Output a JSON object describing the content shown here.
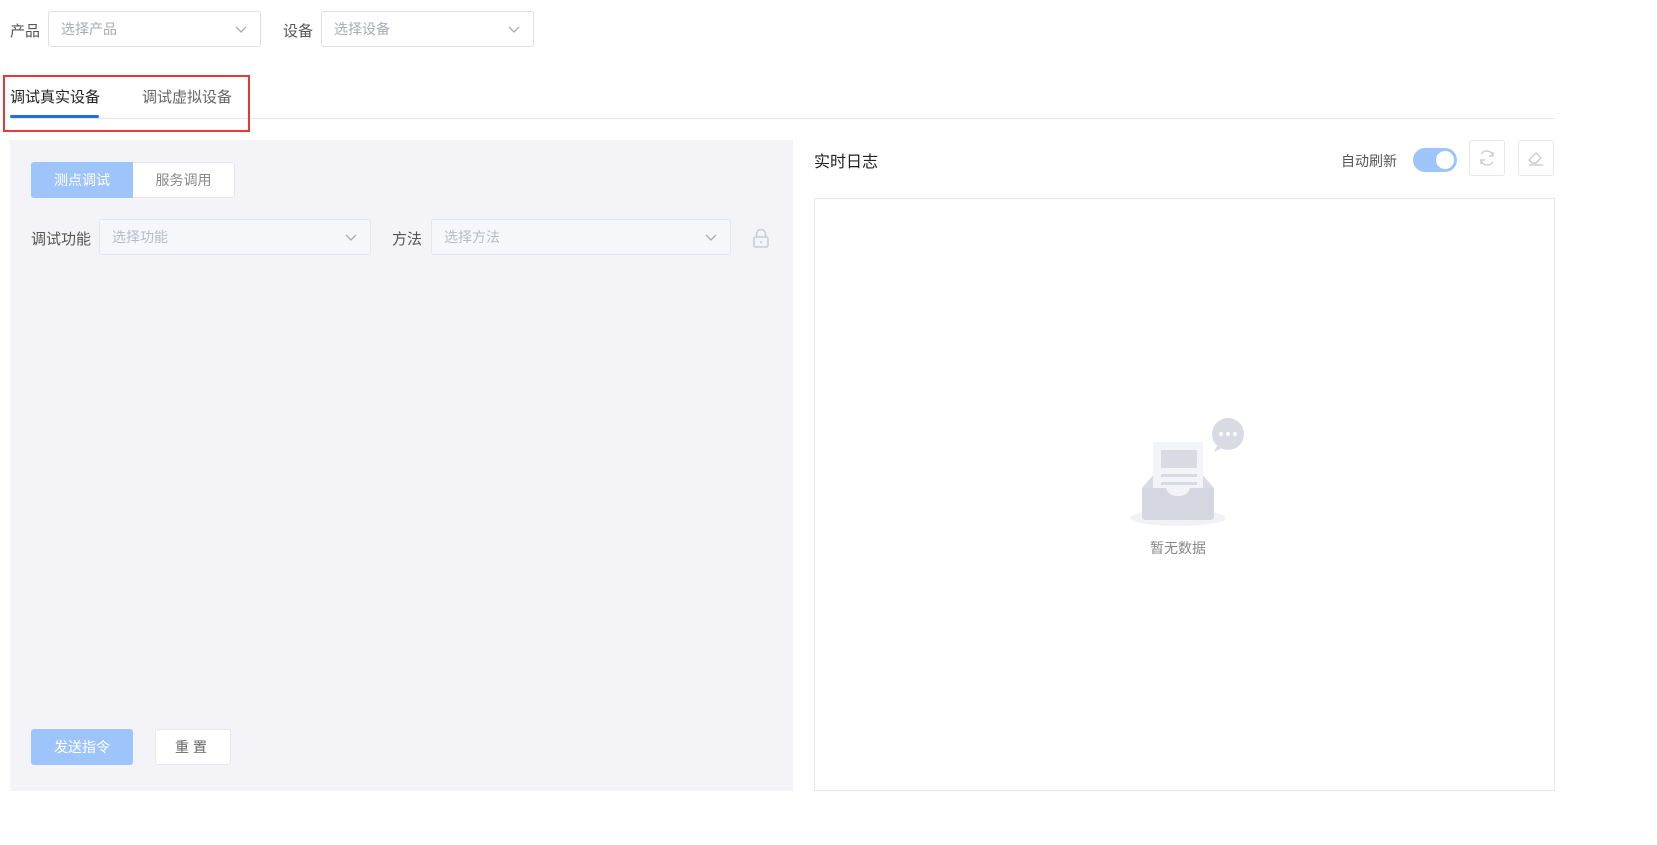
{
  "filters": {
    "product_label": "产品",
    "product_placeholder": "选择产品",
    "device_label": "设备",
    "device_placeholder": "选择设备"
  },
  "tabs": [
    {
      "label": "调试真实设备",
      "active": true
    },
    {
      "label": "调试虚拟设备",
      "active": false
    }
  ],
  "debug_panel": {
    "segments": [
      {
        "label": "测点调试",
        "active": true
      },
      {
        "label": "服务调用",
        "active": false
      }
    ],
    "function_label": "调试功能",
    "function_placeholder": "选择功能",
    "method_label": "方法",
    "method_placeholder": "选择方法",
    "send_button": "发送指令",
    "reset_button": "重置"
  },
  "log_panel": {
    "title": "实时日志",
    "auto_refresh_label": "自动刷新",
    "auto_refresh_on": true,
    "empty_text": "暂无数据"
  },
  "icons": {
    "refresh": "refresh-icon",
    "clear": "eraser-icon",
    "lock": "lock-icon",
    "empty": "empty-inbox-icon"
  },
  "colors": {
    "accent": "#1f6fe0",
    "accent_light": "#9ec5fb",
    "highlight_box": "#e53935"
  }
}
